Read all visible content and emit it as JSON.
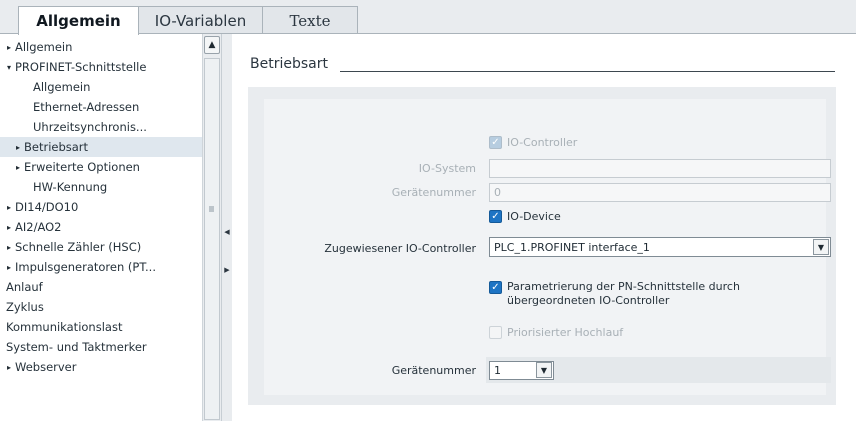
{
  "tabs": [
    "Allgemein",
    "IO-Variablen",
    "Texte"
  ],
  "nav": {
    "items": [
      {
        "label": "Allgemein",
        "arrow": "▸"
      },
      {
        "label": "PROFINET-Schnittstelle",
        "arrow": "▾"
      },
      {
        "label": "Allgemein",
        "arrow": ""
      },
      {
        "label": "Ethernet-Adressen",
        "arrow": ""
      },
      {
        "label": "Uhrzeitsynchronis...",
        "arrow": ""
      },
      {
        "label": "Betriebsart",
        "arrow": "▸"
      },
      {
        "label": "Erweiterte Optionen",
        "arrow": "▸"
      },
      {
        "label": "HW-Kennung",
        "arrow": ""
      },
      {
        "label": "DI14/DO10",
        "arrow": "▸"
      },
      {
        "label": "AI2/AO2",
        "arrow": "▸"
      },
      {
        "label": "Schnelle Zähler (HSC)",
        "arrow": "▸"
      },
      {
        "label": "Impulsgeneratoren (PT...",
        "arrow": "▸"
      },
      {
        "label": "Anlauf",
        "arrow": ""
      },
      {
        "label": "Zyklus",
        "arrow": ""
      },
      {
        "label": "Kommunikationslast",
        "arrow": ""
      },
      {
        "label": "System- und Taktmerker",
        "arrow": ""
      },
      {
        "label": "Webserver",
        "arrow": "▸"
      }
    ]
  },
  "content": {
    "section_title": "Betriebsart",
    "io_controller": {
      "label": "IO-Controller",
      "checked": true,
      "enabled": false
    },
    "io_system": {
      "label": "IO-System",
      "value": ""
    },
    "geraetenummer_top": {
      "label": "Gerätenummer",
      "value": "0"
    },
    "io_device": {
      "label": "IO-Device",
      "checked": true
    },
    "assigned_controller": {
      "label": "Zugewiesener IO-Controller",
      "value": "PLC_1.PROFINET interface_1"
    },
    "parametrierung": {
      "line1": "Parametrierung der PN-Schnittstelle durch",
      "line2": "übergeordneten IO-Controller",
      "checked": true
    },
    "priorisierter": {
      "label": "Priorisierter Hochlauf",
      "checked": false,
      "enabled": false
    },
    "geraetenummer": {
      "label": "Gerätenummer",
      "value": "1"
    }
  },
  "colors": {
    "accent": "#1e74c4",
    "panel_bg": "#e9ecef",
    "disabled_text": "#a8b0b6"
  }
}
